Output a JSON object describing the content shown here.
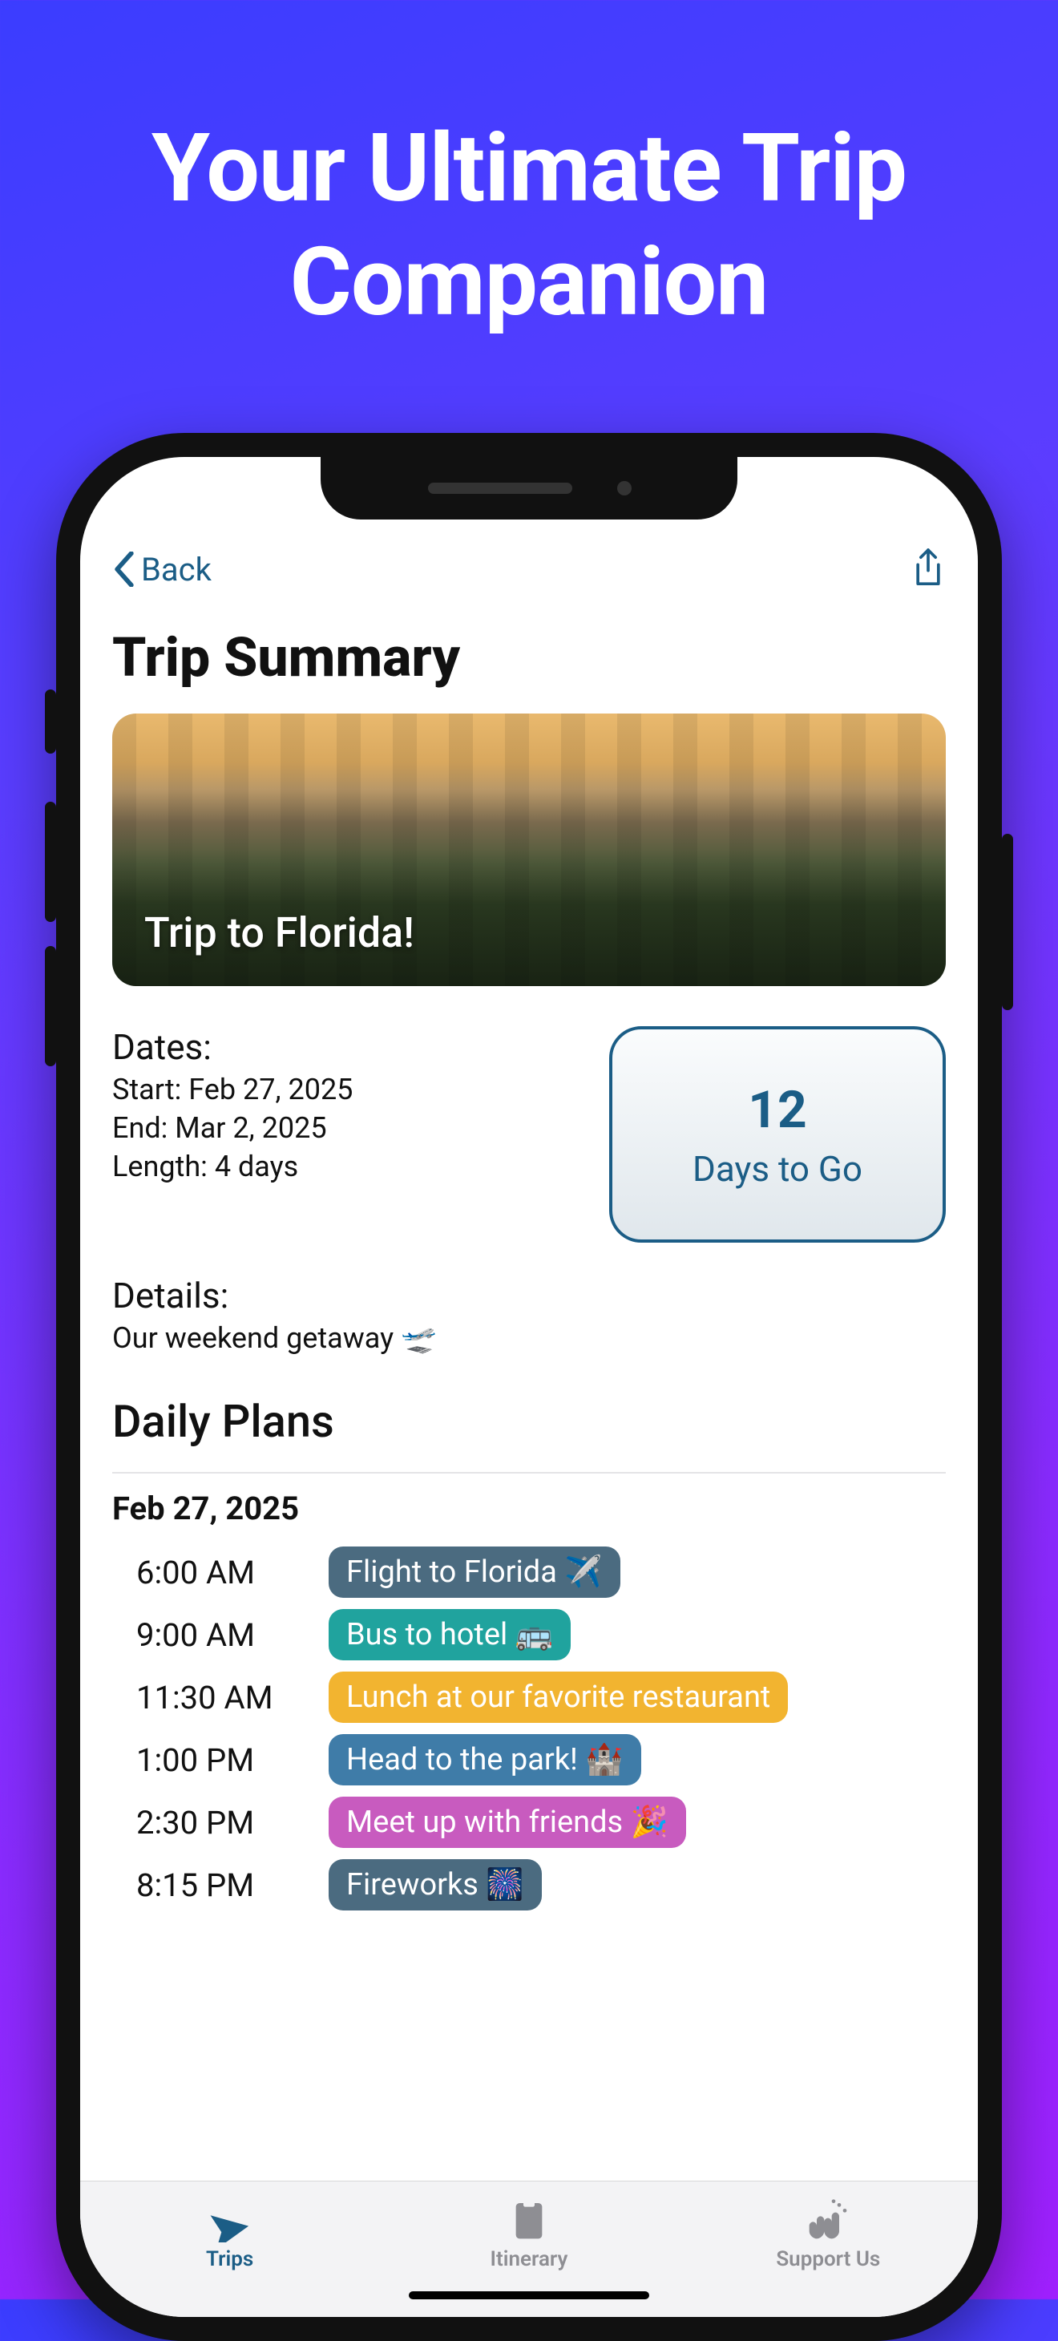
{
  "marketing_headline": "Your Ultimate Trip Companion",
  "nav": {
    "back_label": "Back"
  },
  "page_title": "Trip Summary",
  "hero": {
    "title": "Trip to Florida!"
  },
  "dates": {
    "heading": "Dates:",
    "start": "Start: Feb 27, 2025",
    "end": "End: Mar 2, 2025",
    "length": "Length: 4 days"
  },
  "countdown": {
    "number": "12",
    "label": "Days to Go"
  },
  "details": {
    "heading": "Details:",
    "text": "Our weekend getaway 🛫"
  },
  "daily_plans_heading": "Daily Plans",
  "day": {
    "date": "Feb 27, 2025",
    "items": [
      {
        "time": "6:00 AM",
        "text": "Flight to Florida ✈️",
        "color": "#4b6b80"
      },
      {
        "time": "9:00 AM",
        "text": "Bus to hotel 🚌",
        "color": "#20a39e"
      },
      {
        "time": "11:30 AM",
        "text": "Lunch at our favorite restaurant",
        "color": "#f2b430"
      },
      {
        "time": "1:00 PM",
        "text": "Head to the park! 🏰",
        "color": "#3f7ca8"
      },
      {
        "time": "2:30 PM",
        "text": "Meet up with friends 🎉",
        "color": "#c85bbf"
      },
      {
        "time": "8:15 PM",
        "text": "Fireworks 🎆",
        "color": "#4b6b80"
      }
    ]
  },
  "tabs": [
    {
      "label": "Trips",
      "active": true
    },
    {
      "label": "Itinerary",
      "active": false
    },
    {
      "label": "Support Us",
      "active": false
    }
  ]
}
